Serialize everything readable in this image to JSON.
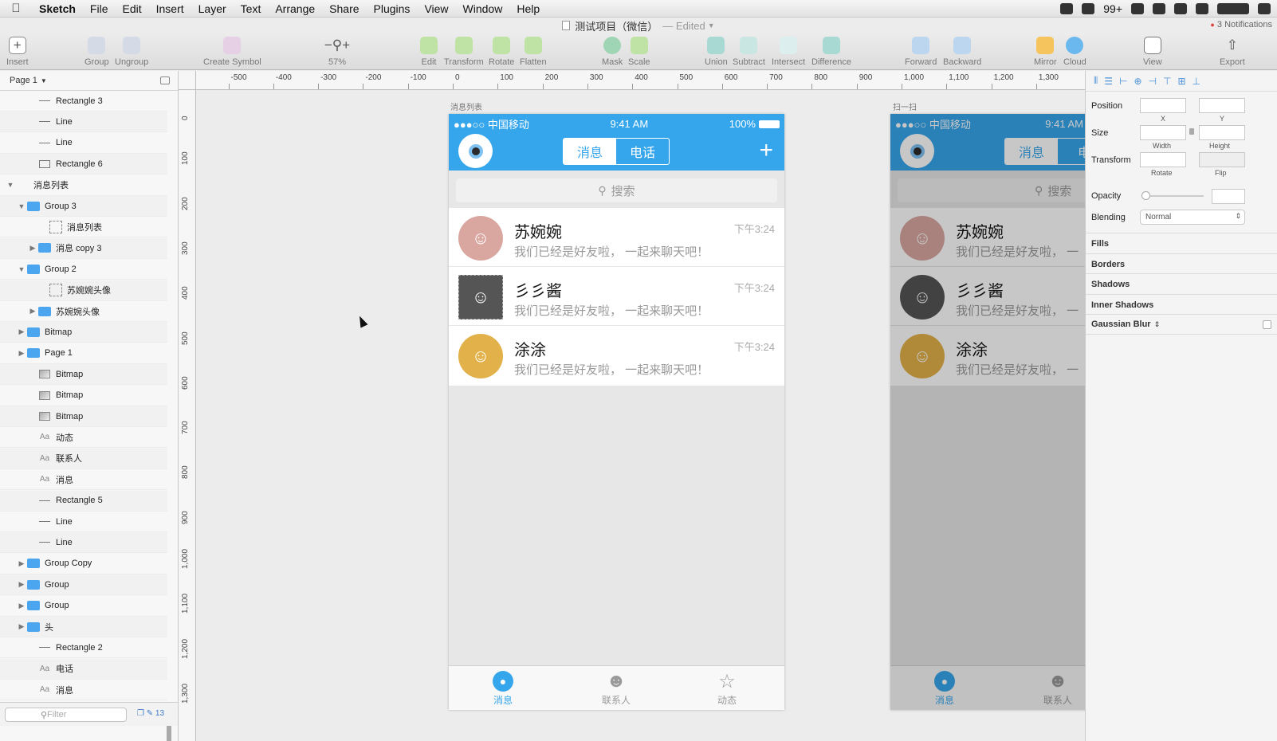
{
  "menubar": {
    "apple": "",
    "items": [
      "Sketch",
      "File",
      "Edit",
      "Insert",
      "Layer",
      "Text",
      "Arrange",
      "Share",
      "Plugins",
      "View",
      "Window",
      "Help"
    ],
    "badge": "99+"
  },
  "titlebar": {
    "doc_title": "测试项目（微信）",
    "edited": "— Edited"
  },
  "notifications": "3 Notifications",
  "toolbar": {
    "insert": "Insert",
    "group": "Group",
    "ungroup": "Ungroup",
    "create_symbol": "Create Symbol",
    "zoom": "57%",
    "edit": "Edit",
    "transform": "Transform",
    "rotate": "Rotate",
    "flatten": "Flatten",
    "mask": "Mask",
    "scale": "Scale",
    "union": "Union",
    "subtract": "Subtract",
    "intersect": "Intersect",
    "difference": "Difference",
    "forward": "Forward",
    "backward": "Backward",
    "mirror": "Mirror",
    "cloud": "Cloud",
    "view": "View",
    "export": "Export"
  },
  "layers": {
    "page": "Page 1",
    "items": [
      {
        "label": "Rectangle 3",
        "kind": "line",
        "indent": 2,
        "arrow": ""
      },
      {
        "label": "Line",
        "kind": "line",
        "indent": 2,
        "arrow": ""
      },
      {
        "label": "Line",
        "kind": "line",
        "indent": 2,
        "arrow": ""
      },
      {
        "label": "Rectangle 6",
        "kind": "rect",
        "indent": 2,
        "arrow": ""
      },
      {
        "label": "消息列表",
        "kind": "none",
        "indent": 0,
        "arrow": "▼"
      },
      {
        "label": "Group 3",
        "kind": "folder",
        "indent": 1,
        "arrow": "▼"
      },
      {
        "label": "消息列表",
        "kind": "dash",
        "indent": 3,
        "arrow": ""
      },
      {
        "label": "消息 copy 3",
        "kind": "folder",
        "indent": 2,
        "arrow": "▶"
      },
      {
        "label": "Group 2",
        "kind": "folder",
        "indent": 1,
        "arrow": "▼"
      },
      {
        "label": "苏婉婉头像",
        "kind": "dash",
        "indent": 3,
        "arrow": ""
      },
      {
        "label": "苏婉婉头像",
        "kind": "folder",
        "indent": 2,
        "arrow": "▶"
      },
      {
        "label": "Bitmap",
        "kind": "folder",
        "indent": 1,
        "arrow": "▶"
      },
      {
        "label": "Page 1",
        "kind": "folder",
        "indent": 1,
        "arrow": "▶"
      },
      {
        "label": "Bitmap",
        "kind": "bitmap",
        "indent": 2,
        "arrow": ""
      },
      {
        "label": "Bitmap",
        "kind": "bitmap",
        "indent": 2,
        "arrow": ""
      },
      {
        "label": "Bitmap",
        "kind": "bitmap",
        "indent": 2,
        "arrow": ""
      },
      {
        "label": "动态",
        "kind": "text",
        "indent": 2,
        "arrow": ""
      },
      {
        "label": "联系人",
        "kind": "text",
        "indent": 2,
        "arrow": ""
      },
      {
        "label": "消息",
        "kind": "text",
        "indent": 2,
        "arrow": ""
      },
      {
        "label": "Rectangle 5",
        "kind": "line",
        "indent": 2,
        "arrow": ""
      },
      {
        "label": "Line",
        "kind": "line",
        "indent": 2,
        "arrow": ""
      },
      {
        "label": "Line",
        "kind": "line",
        "indent": 2,
        "arrow": ""
      },
      {
        "label": "Group Copy",
        "kind": "folder",
        "indent": 1,
        "arrow": "▶"
      },
      {
        "label": "Group",
        "kind": "folder",
        "indent": 1,
        "arrow": "▶"
      },
      {
        "label": "Group",
        "kind": "folder",
        "indent": 1,
        "arrow": "▶"
      },
      {
        "label": "头",
        "kind": "folder",
        "indent": 1,
        "arrow": "▶"
      },
      {
        "label": "Rectangle 2",
        "kind": "line",
        "indent": 2,
        "arrow": ""
      },
      {
        "label": "电话",
        "kind": "text",
        "indent": 2,
        "arrow": ""
      },
      {
        "label": "消息",
        "kind": "text",
        "indent": 2,
        "arrow": ""
      }
    ],
    "filter_placeholder": "Filter",
    "count": "13"
  },
  "rulers": {
    "top": [
      "-500",
      "-400",
      "-300",
      "-200",
      "-100",
      "0",
      "100",
      "200",
      "300",
      "400",
      "500",
      "600",
      "700",
      "800",
      "900",
      "1,000",
      "1,100",
      "1,200",
      "1,300"
    ],
    "left": [
      "0",
      "100",
      "200",
      "300",
      "400",
      "500",
      "600",
      "700",
      "800",
      "900",
      "1,000",
      "1,100",
      "1,200",
      "1,300"
    ]
  },
  "artboard1": {
    "label": "消息列表",
    "status": {
      "carrier": "●●●○○ 中国移动",
      "time": "9:41 AM",
      "battery": "100%"
    },
    "seg": [
      "消息",
      "电话"
    ],
    "plus": "+",
    "search": "搜索",
    "messages": [
      {
        "name": "苏婉婉",
        "msg": "我们已经是好友啦， 一起来聊天吧！",
        "time": "下午3:24"
      },
      {
        "name": "彡彡酱",
        "msg": "我们已经是好友啦， 一起来聊天吧！",
        "time": "下午3:24"
      },
      {
        "name": "涂涂",
        "msg": "我们已经是好友啦， 一起来聊天吧！",
        "time": "下午3:24"
      }
    ],
    "tabs": [
      "消息",
      "联系人",
      "动态"
    ]
  },
  "artboard2": {
    "label": "扫一扫",
    "status": {
      "carrier": "●●●○○ 中国移动",
      "time": "9:41 AM"
    },
    "seg": [
      "消息",
      "电"
    ],
    "search": "搜索",
    "messages": [
      {
        "name": "苏婉婉",
        "msg": "我们已经是好友啦， 一"
      },
      {
        "name": "彡彡酱",
        "msg": "我们已经是好友啦， 一"
      },
      {
        "name": "涂涂",
        "msg": "我们已经是好友啦， 一"
      }
    ],
    "tabs": [
      "消息",
      "联系人"
    ]
  },
  "inspector": {
    "position": "Position",
    "x": "X",
    "y": "Y",
    "size": "Size",
    "width": "Width",
    "height": "Height",
    "transform": "Transform",
    "rotate": "Rotate",
    "flip": "Flip",
    "opacity": "Opacity",
    "blending": "Blending",
    "blend_value": "Normal",
    "fills": "Fills",
    "borders": "Borders",
    "shadows": "Shadows",
    "inner_shadows": "Inner Shadows",
    "gaussian_blur": "Gaussian Blur"
  },
  "colors": {
    "accent": "#36a6ec",
    "folder": "#4ca6ef"
  }
}
